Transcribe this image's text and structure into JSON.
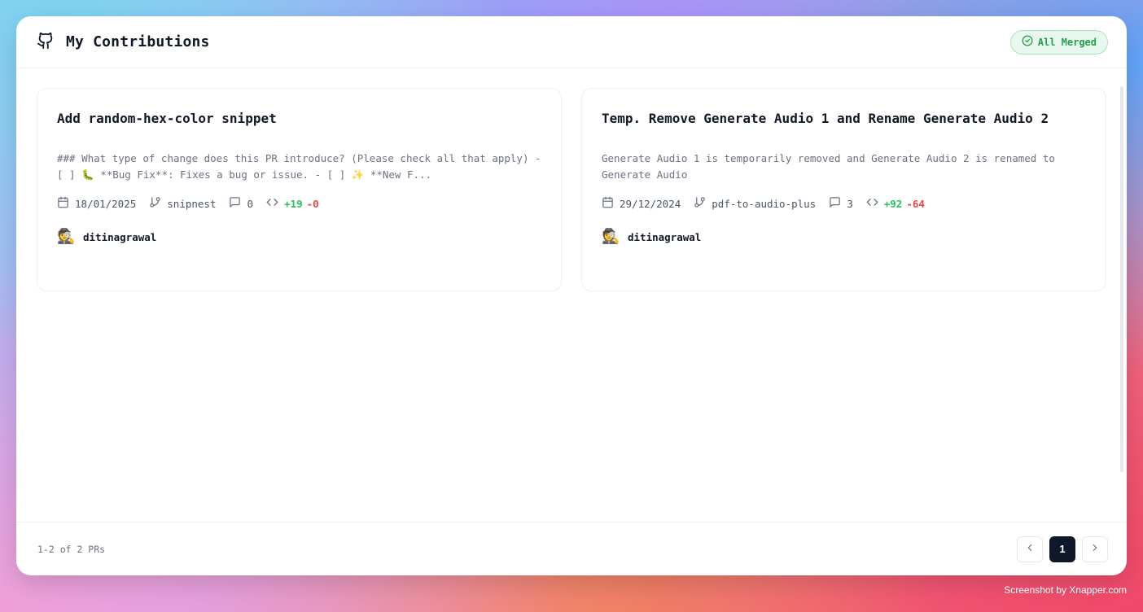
{
  "header": {
    "title": "My Contributions",
    "badge": "All Merged",
    "accent_green": "#22a04b"
  },
  "cards": [
    {
      "title": "Add random-hex-color snippet",
      "description": "### What type of change does this PR introduce? (Please check all that apply) - [ ] 🐛 **Bug Fix**: Fixes a bug or issue. - [ ] ✨ **New F...",
      "date": "18/01/2025",
      "repo": "snipnest",
      "comments": "0",
      "additions": "+19",
      "deletions": "-0",
      "author": "ditinagrawal",
      "avatar": "🕵️"
    },
    {
      "title": "Temp. Remove Generate Audio 1 and Rename Generate Audio 2",
      "description": "Generate Audio 1 is temporarily removed and Generate Audio 2 is renamed to Generate Audio",
      "date": "29/12/2024",
      "repo": "pdf-to-audio-plus",
      "comments": "3",
      "additions": "+92",
      "deletions": "-64",
      "author": "ditinagrawal",
      "avatar": "🕵️"
    }
  ],
  "footer": {
    "count_text": "1-2 of 2 PRs",
    "current_page": "1",
    "prev_icon": "chevron-left-icon",
    "next_icon": "chevron-right-icon"
  },
  "watermark": "Screenshot by Xnapper.com"
}
